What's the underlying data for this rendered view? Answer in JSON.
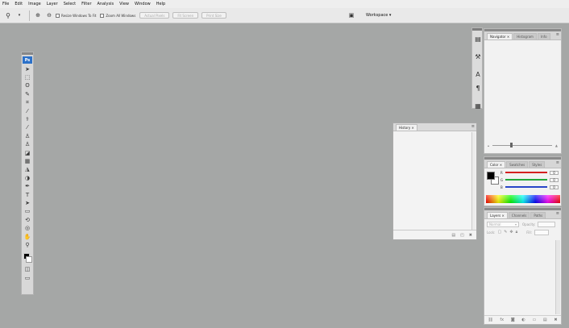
{
  "menu": [
    "File",
    "Edit",
    "Image",
    "Layer",
    "Select",
    "Filter",
    "Analysis",
    "View",
    "Window",
    "Help"
  ],
  "options": {
    "tool_icon": "zoom-icon",
    "resize_windows_label": "Resize Windows To Fit",
    "zoom_all_windows_label": "Zoom All Windows",
    "actual_pixels_label": "Actual Pixels",
    "fit_screen_label": "Fit Screen",
    "print_size_label": "Print Size",
    "workspace_label": "Workspace ▾"
  },
  "toolbar": {
    "logo": "Ps",
    "tools": [
      "move",
      "marquee",
      "lasso",
      "quick-selection",
      "crop",
      "eyedropper",
      "healing-brush",
      "brush",
      "clone-stamp",
      "history-brush",
      "eraser",
      "gradient",
      "blur",
      "dodge",
      "pen",
      "type",
      "path-selection",
      "shape",
      "3d-rotate",
      "3d-orbit",
      "hand",
      "zoom"
    ],
    "tool_glyphs": [
      "➤",
      "⬚",
      "ʘ",
      "✎",
      "⌗",
      "⁄",
      "⚕",
      "⁄",
      "♙",
      "♙",
      "◪",
      "▦",
      "◮",
      "◑",
      "✒",
      "T",
      "➤",
      "▭",
      "⟲",
      "◎",
      "✋",
      "⚲"
    ],
    "foreground_color": "#000000",
    "background_color": "#ffffff"
  },
  "floating_panel": {
    "tab": "History ×"
  },
  "navigator_panel": {
    "tabs": [
      "Navigator ×",
      "Histogram",
      "Info"
    ]
  },
  "color_panel": {
    "tabs": [
      "Color ×",
      "Swatches",
      "Styles"
    ],
    "channels": [
      {
        "label": "R",
        "value": "0",
        "color": "#d42020"
      },
      {
        "label": "G",
        "value": "0",
        "color": "#22a83a"
      },
      {
        "label": "B",
        "value": "0",
        "color": "#2846c8"
      }
    ]
  },
  "layers_panel": {
    "tabs": [
      "Layers ×",
      "Channels",
      "Paths"
    ],
    "blend_mode": "Normal",
    "opacity_label": "Opacity:",
    "lock_label": "Lock:",
    "fill_label": "Fill:"
  },
  "colors": {
    "canvas_bg": "#a5a7a6",
    "panel_bg": "#f2f2f2",
    "menubar_bg": "#eeeeee"
  }
}
